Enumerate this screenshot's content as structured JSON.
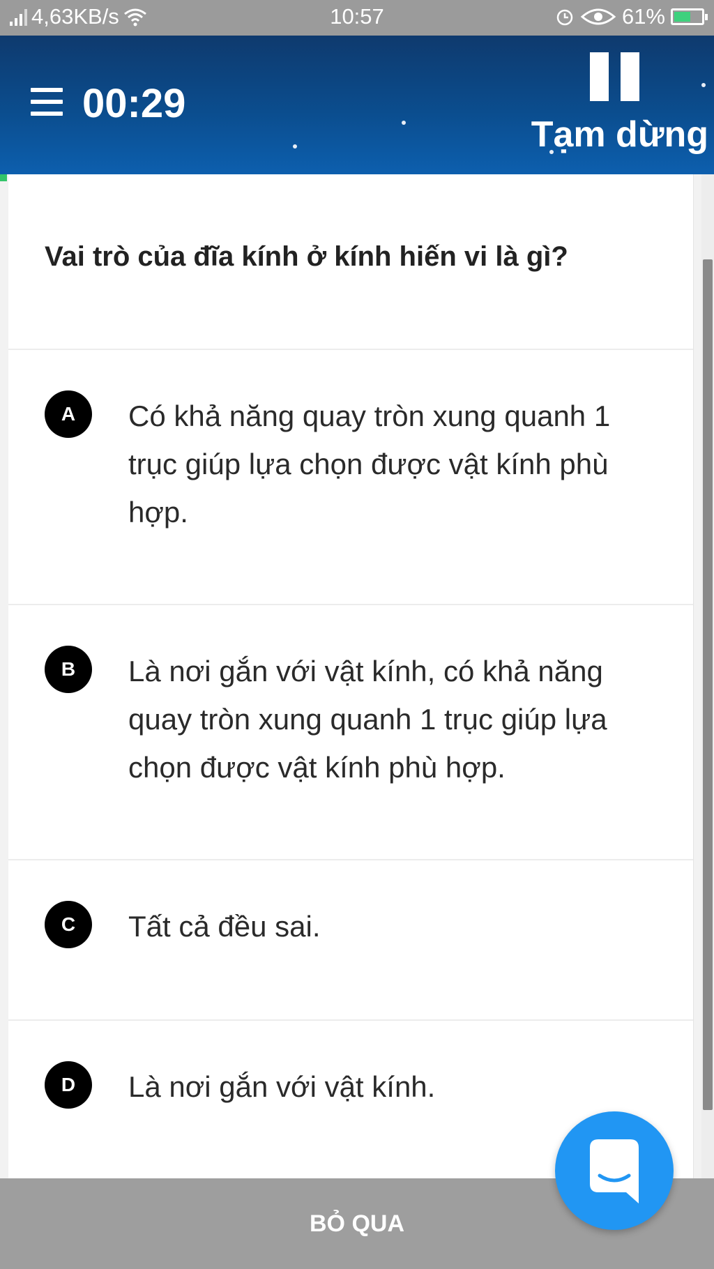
{
  "status_bar": {
    "network_speed": "4,63KB/s",
    "time": "10:57",
    "battery": "61%",
    "battery_level": 0.61,
    "icons": [
      "signal-icon",
      "wifi-icon",
      "alarm-icon",
      "eye-icon",
      "battery-charging-icon"
    ]
  },
  "header": {
    "timer": "00:29",
    "pause_label": "Tạm dừng",
    "background": "#0b4d8e"
  },
  "question": {
    "text": "Vai trò của đĩa kính ở kính hiến vi là gì?"
  },
  "options": [
    {
      "letter": "A",
      "text": "Có khả năng quay tròn xung quanh 1 trục giúp lựa chọn được vật kính phù hợp."
    },
    {
      "letter": "B",
      "text": "Là nơi gắn với vật kính, có khả năng quay tròn xung quanh 1 trục giúp lựa chọn được vật kính phù hợp."
    },
    {
      "letter": "C",
      "text": "Tất cả đều sai."
    },
    {
      "letter": "D",
      "text": "Là nơi gắn với vật kính."
    }
  ],
  "bottom": {
    "skip_label": "BỎ QUA"
  },
  "colors": {
    "accent": "#2196f3",
    "badge": "#000000",
    "progress_green": "#33c56a"
  }
}
